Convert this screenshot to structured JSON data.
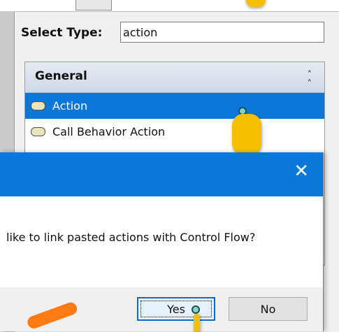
{
  "palette": {
    "select_type_label": "Select Type:",
    "select_type_value": "action",
    "group": {
      "title": "General",
      "collapse_icon": "double-chevron-up-icon"
    },
    "items": [
      {
        "label": "Action",
        "icon": "action-node-icon",
        "selected": true
      },
      {
        "label": "Call Behavior Action",
        "icon": "action-node-icon",
        "selected": false
      }
    ]
  },
  "dialog": {
    "close_icon": "close-icon",
    "message": "like to link pasted actions with Control Flow?",
    "buttons": {
      "yes": "Yes",
      "no": "No"
    }
  },
  "colors": {
    "accent": "#0b77d8",
    "selection": "#0b77d8",
    "annotation_cursor": "#f6c000",
    "annotation_stroke": "#ff7a12",
    "action_fill": "#e9e4b9"
  }
}
